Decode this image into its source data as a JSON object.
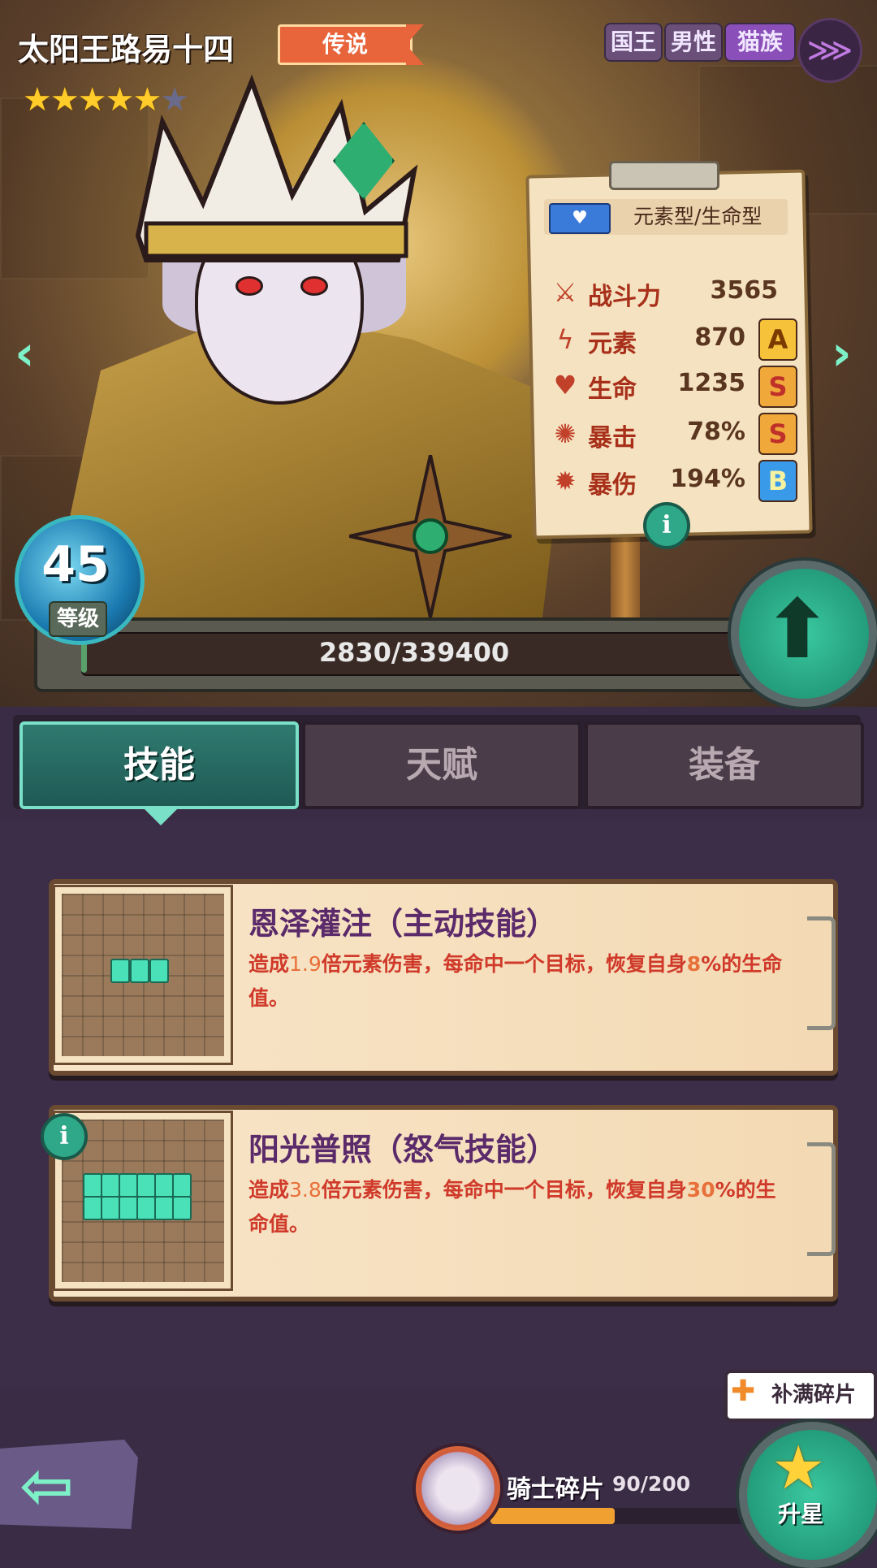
{
  "hero": {
    "name": "太阳王路易十四",
    "rarity": "传说",
    "tags": [
      "国王",
      "男性",
      "猫族"
    ],
    "race_icon": "fish-bone-icon",
    "stars_filled": 5,
    "stars_total": 6
  },
  "stats_board": {
    "type": "元素型/生命型",
    "type_icon": "heart-badge-icon",
    "rows": [
      {
        "icon": "swords-icon",
        "label": "战斗力",
        "value": "3565",
        "grade": ""
      },
      {
        "icon": "lightning-icon",
        "label": "元素",
        "value": "870",
        "grade": "A"
      },
      {
        "icon": "heart-icon",
        "label": "生命",
        "value": "1235",
        "grade": "S"
      },
      {
        "icon": "crit-icon",
        "label": "暴击",
        "value": "78%",
        "grade": "S"
      },
      {
        "icon": "burst-icon",
        "label": "暴伤",
        "value": "194%",
        "grade": "B"
      }
    ]
  },
  "level": {
    "value": "45",
    "label": "等级"
  },
  "exp": {
    "text": "2830/339400",
    "progress": 0.0083
  },
  "tabs": [
    {
      "label": "技能",
      "active": true
    },
    {
      "label": "天赋",
      "active": false
    },
    {
      "label": "装备",
      "active": false
    }
  ],
  "skills": [
    {
      "title": "恩泽灌注（主动技能）",
      "desc_pre": "造成",
      "desc_mult": "1.9",
      "desc_mid": "倍元素伤害，每命中一个目标，恢复自身",
      "desc_pct": "8",
      "desc_post": "%的生命值。",
      "cells": 3
    },
    {
      "title": "阳光普照（怒气技能）",
      "desc_pre": "造成",
      "desc_mult": "3.8",
      "desc_mid": "倍元素伤害，每命中一个目标，恢复自身",
      "desc_pct": "30",
      "desc_post": "%的生命值。",
      "cells": 12
    }
  ],
  "fragments": {
    "label": "骑士碎片",
    "count": "90/200",
    "progress": 0.45
  },
  "refill": {
    "label": "补满碎片"
  },
  "star_up": {
    "label": "升星"
  },
  "colors": {
    "accent": "#7ae0c8",
    "exp_fill": "#5aa06a",
    "fragment_fill": "#f0a030"
  }
}
